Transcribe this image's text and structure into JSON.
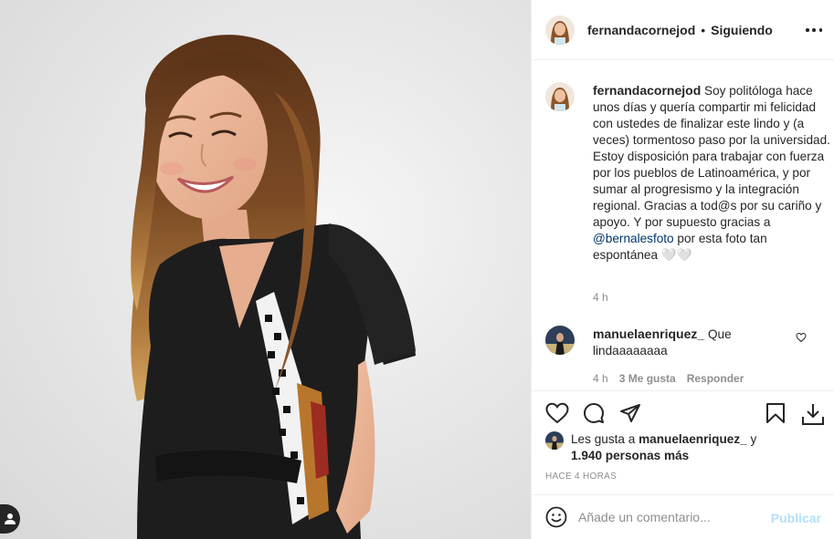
{
  "post": {
    "username": "fernandacornejod",
    "follow_status": "Siguiendo",
    "dot": "•",
    "more_icon": "ellipsis-icon"
  },
  "caption": {
    "username": "fernandacornejod",
    "text_before": "Soy politóloga hace unos días y quería compartir mi felicidad con ustedes de finalizar este lindo y (a veces) tormentoso paso por la universidad. Estoy disposición para trabajar con fuerza por los pueblos de Latinoamérica, y por sumar al progresismo y la integración regional. Gracias a tod@s por su cariño y apoyo. Y por supuesto gracias a ",
    "mention": "@bernalesfoto",
    "text_after": " por esta foto tan espontánea ",
    "emoji": "🤍🤍",
    "time": "4 h"
  },
  "comment": {
    "username": "manuelaenriquez_",
    "text": "Que lindaaaaaaaa",
    "time": "4 h",
    "likes": "3 Me gusta",
    "reply": "Responder"
  },
  "likes": {
    "prefix": "Les gusta a",
    "user": "manuelaenriquez_",
    "conj": "y",
    "others": "1.940 personas más"
  },
  "date": "HACE 4 HORAS",
  "add_comment": {
    "placeholder": "Añade un comentario...",
    "publish": "Publicar"
  },
  "icons": [
    "heart-icon",
    "comment-icon",
    "share-icon",
    "bookmark-icon",
    "download-icon",
    "emoji-icon",
    "user-tag-icon"
  ],
  "colors": {
    "text": "#262626",
    "muted": "#8e8e8e",
    "link": "#00376b",
    "publish_disabled": "#b2dffc",
    "border": "#efefef"
  }
}
